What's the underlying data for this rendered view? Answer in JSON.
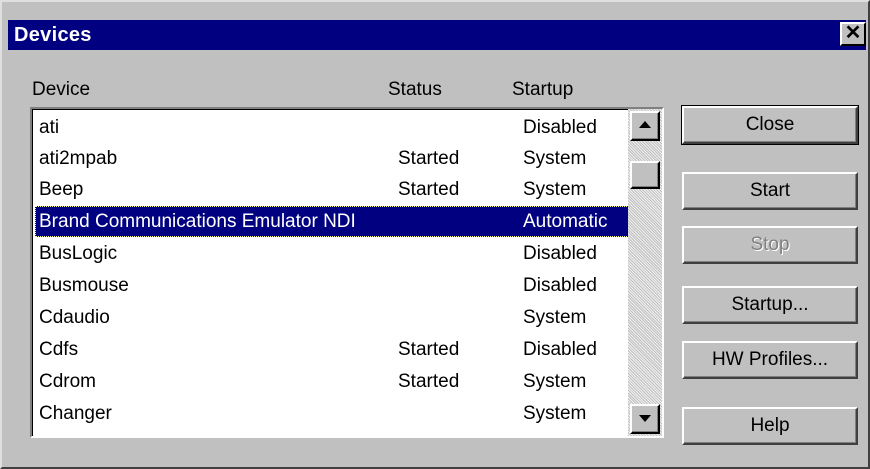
{
  "window": {
    "title": "Devices",
    "close_glyph": "✕"
  },
  "columns": {
    "device": "Device",
    "status": "Status",
    "startup": "Startup"
  },
  "devices": [
    {
      "name": "ati",
      "status": "",
      "startup": "Disabled"
    },
    {
      "name": "ati2mpab",
      "status": "Started",
      "startup": "System"
    },
    {
      "name": "Beep",
      "status": "Started",
      "startup": "System"
    },
    {
      "name": "Brand Communications Emulator NDI",
      "status": "",
      "startup": "Automatic"
    },
    {
      "name": "BusLogic",
      "status": "",
      "startup": "Disabled"
    },
    {
      "name": "Busmouse",
      "status": "",
      "startup": "Disabled"
    },
    {
      "name": "Cdaudio",
      "status": "",
      "startup": "System"
    },
    {
      "name": "Cdfs",
      "status": "Started",
      "startup": "Disabled"
    },
    {
      "name": "Cdrom",
      "status": "Started",
      "startup": "System"
    },
    {
      "name": "Changer",
      "status": "",
      "startup": "System"
    }
  ],
  "buttons": {
    "close": "Close",
    "start": "Start",
    "stop": "Stop",
    "startup": "Startup...",
    "hw_profiles": "HW Profiles...",
    "help": "Help"
  },
  "icons": {
    "scroll_up": "up-arrow-icon",
    "scroll_down": "down-arrow-icon"
  },
  "colors": {
    "titlebar": "#000080",
    "selection": "#000080",
    "face": "#c0c0c0"
  }
}
